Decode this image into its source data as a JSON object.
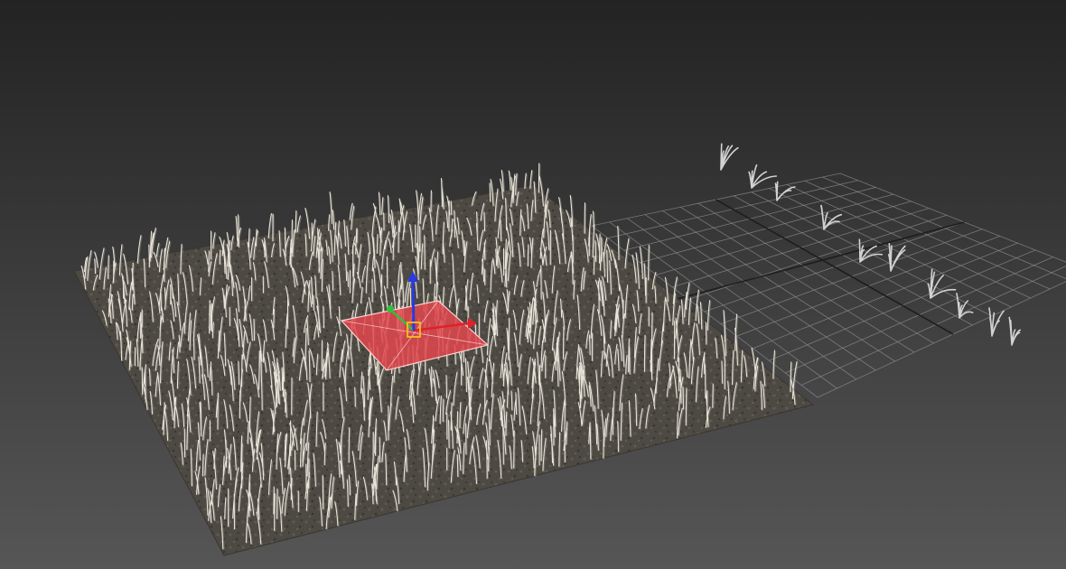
{
  "viewport": {
    "background_top": "#232323",
    "background_bottom": "#565656"
  },
  "ground_plane": {
    "color": "#4a4640",
    "edge_color": "#3a3630"
  },
  "grass": {
    "blade_color": "#e8e4da",
    "blade_shadow": "#8a857a"
  },
  "home_grid": {
    "line_color": "#8e8e8e",
    "axis_color": "#1e1e1e"
  },
  "source_grass": {
    "color": "#d2d2d2"
  },
  "selection": {
    "fill_color": "#e0474c",
    "outline_color": "#ffd0d0"
  },
  "gizmo": {
    "x_axis_color": "#e0202a",
    "y_axis_color": "#30c040",
    "z_axis_color": "#2a3ae0",
    "center_color": "#f0c020"
  }
}
